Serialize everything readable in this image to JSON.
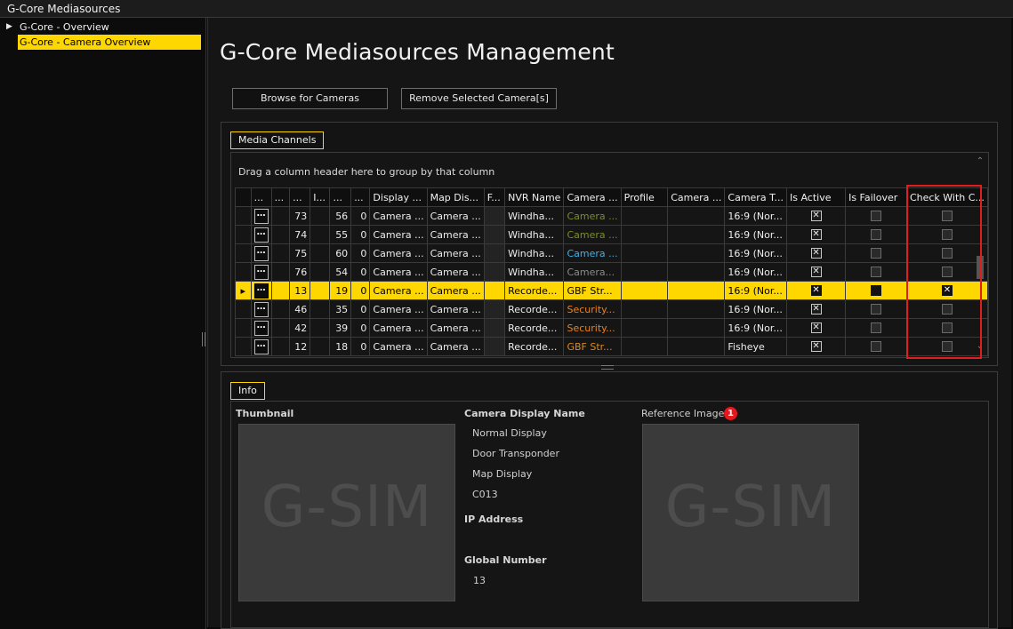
{
  "window": {
    "title": "G-Core Mediasources"
  },
  "tree": {
    "items": [
      {
        "label": "G-Core - Overview"
      },
      {
        "label": "G-Core - Camera Overview"
      }
    ]
  },
  "page": {
    "title": "G-Core Mediasources Management"
  },
  "toolbar": {
    "browse_label": "Browse for Cameras",
    "remove_label": "Remove Selected Camera[s]"
  },
  "channels": {
    "tab_label": "Media Channels",
    "group_hint": "Drag a column header here to group by that column",
    "columns": [
      "",
      "...",
      "...",
      "...",
      "I...",
      "...",
      "...",
      "Display ...",
      "Map Dis...",
      "F...",
      "NVR Name",
      "Camera ...",
      "Profile",
      "Camera ...",
      "Camera T...",
      "Is Active",
      "Is Failover",
      "Check With C..."
    ],
    "rows": [
      {
        "c4": "73",
        "c5": "56",
        "c6": "0",
        "display": "Camera ...",
        "map": "Camera ...",
        "nvr": "Windha...",
        "camera": "Camera ...",
        "camera_color": "#7b8c2c",
        "profile": "",
        "cam2": "",
        "ratio": "16:9 (Nor...",
        "is_active": true,
        "is_failover": false,
        "check": false
      },
      {
        "c4": "74",
        "c5": "55",
        "c6": "0",
        "display": "Camera ...",
        "map": "Camera ...",
        "nvr": "Windha...",
        "camera": "Camera ...",
        "camera_color": "#7b8c2c",
        "profile": "",
        "cam2": "",
        "ratio": "16:9 (Nor...",
        "is_active": true,
        "is_failover": false,
        "check": false
      },
      {
        "c4": "75",
        "c5": "60",
        "c6": "0",
        "display": "Camera ...",
        "map": "Camera ...",
        "nvr": "Windha...",
        "camera": "Camera ...",
        "camera_color": "#3fb2e8",
        "profile": "",
        "cam2": "",
        "ratio": "16:9 (Nor...",
        "is_active": true,
        "is_failover": false,
        "check": false
      },
      {
        "c4": "76",
        "c5": "54",
        "c6": "0",
        "display": "Camera ...",
        "map": "Camera ...",
        "nvr": "Windha...",
        "camera": "Camera...",
        "camera_color": "#8a8a8a",
        "profile": "",
        "cam2": "",
        "ratio": "16:9 (Nor...",
        "is_active": true,
        "is_failover": false,
        "check": false
      },
      {
        "c4": "13",
        "c5": "19",
        "c6": "0",
        "display": "Camera ...",
        "map": "Camera ...",
        "nvr": "Recorde...",
        "camera": "GBF Str...",
        "camera_color": "#000000",
        "profile": "",
        "cam2": "",
        "ratio": "16:9 (Nor...",
        "is_active": true,
        "is_failover": true,
        "check": true,
        "selected": true
      },
      {
        "c4": "46",
        "c5": "35",
        "c6": "0",
        "display": "Camera ...",
        "map": "Camera ...",
        "nvr": "Recorde...",
        "camera": "Security...",
        "camera_color": "#e8831f",
        "profile": "",
        "cam2": "",
        "ratio": "16:9 (Nor...",
        "is_active": true,
        "is_failover": false,
        "check": false
      },
      {
        "c4": "42",
        "c5": "39",
        "c6": "0",
        "display": "Camera ...",
        "map": "Camera ...",
        "nvr": "Recorde...",
        "camera": "Security...",
        "camera_color": "#e8831f",
        "profile": "",
        "cam2": "",
        "ratio": "16:9 (Nor...",
        "is_active": true,
        "is_failover": false,
        "check": false
      },
      {
        "c4": "12",
        "c5": "18",
        "c6": "0",
        "display": "Camera ...",
        "map": "Camera ...",
        "nvr": "Recorde...",
        "camera": "GBF Str...",
        "camera_color": "#d98a1e",
        "profile": "",
        "cam2": "",
        "ratio": "Fisheye",
        "is_active": true,
        "is_failover": false,
        "check": false
      }
    ]
  },
  "info": {
    "tab_label": "Info",
    "thumbnail_label": "Thumbnail",
    "thumbnail_text": "G-SIM",
    "display_name_label": "Camera Display Name",
    "display_names": [
      "Normal Display",
      "Door Transponder",
      "Map Display",
      "C013"
    ],
    "ip_label": "IP Address",
    "global_number_label": "Global Number",
    "global_number": "13",
    "reference_label": "Reference Image",
    "reference_badge": "1",
    "reference_text": "G-SIM"
  }
}
